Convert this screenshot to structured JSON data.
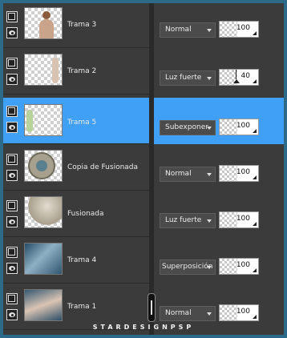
{
  "panel": {
    "layers": [
      {
        "name": "Trama 3",
        "blend": "Normal",
        "opacity": "100",
        "selected": false
      },
      {
        "name": "Trama 2",
        "blend": "Luz fuerte",
        "opacity": "40",
        "selected": false
      },
      {
        "name": "Trama 5",
        "blend": "Subexponer",
        "opacity": "100",
        "selected": true
      },
      {
        "name": "Copia de Fusionada",
        "blend": "Normal",
        "opacity": "100",
        "selected": false
      },
      {
        "name": "Fusionada",
        "blend": "Luz fuerte",
        "opacity": "100",
        "selected": false
      },
      {
        "name": "Trama 4",
        "blend": "Superposición",
        "opacity": "100",
        "selected": false
      },
      {
        "name": "Trama 1",
        "blend": "Normal",
        "opacity": "100",
        "selected": false
      }
    ]
  },
  "watermark": "STARDESIGNPSP",
  "colors": {
    "selection": "#3fa0f5",
    "panel_bg": "#3b3b3b",
    "frame": "#2d6a8a"
  },
  "icons": [
    "group-icon",
    "visibility-eye-icon",
    "dropdown-caret-icon"
  ]
}
